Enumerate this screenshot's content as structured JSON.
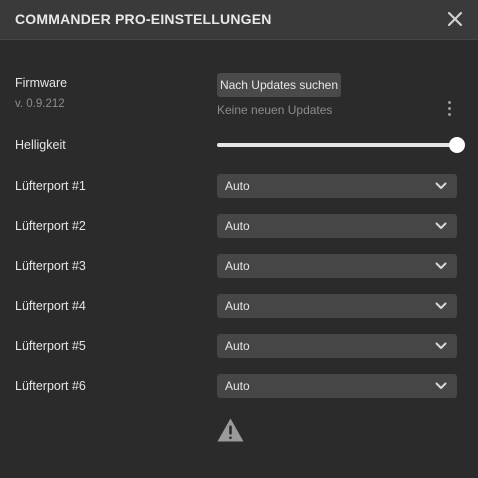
{
  "dialog": {
    "title": "COMMANDER PRO-EINSTELLUNGEN",
    "close_icon": "close-icon"
  },
  "firmware": {
    "label": "Firmware",
    "version": "v. 0.9.212",
    "check_button": "Nach Updates suchen",
    "status": "Keine neuen Updates",
    "menu_icon": "more-vertical-icon"
  },
  "brightness": {
    "label": "Helligkeit",
    "value_fraction": 1.0
  },
  "fan_ports": [
    {
      "label": "Lüfterport #1",
      "value": "Auto"
    },
    {
      "label": "Lüfterport #2",
      "value": "Auto"
    },
    {
      "label": "Lüfterport #3",
      "value": "Auto"
    },
    {
      "label": "Lüfterport #4",
      "value": "Auto"
    },
    {
      "label": "Lüfterport #5",
      "value": "Auto"
    },
    {
      "label": "Lüfterport #6",
      "value": "Auto"
    }
  ],
  "footer": {
    "icon": "warning-icon"
  },
  "colors": {
    "background": "#2b2b2b",
    "header": "#3a3a3a",
    "control": "#464646",
    "text": "#e6e6e6",
    "muted": "#8c8c8c"
  }
}
